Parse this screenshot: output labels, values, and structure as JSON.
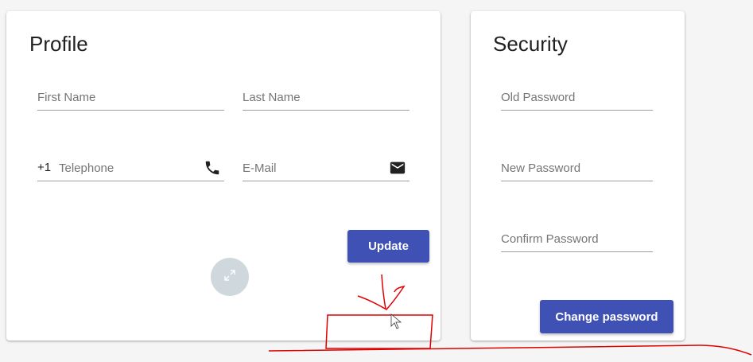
{
  "colors": {
    "page_bg": "#f5f5f5",
    "card_bg": "#ffffff",
    "primary": "#3f51b5",
    "fab": "#cfd8dc",
    "annotation": "#e00000"
  },
  "profile": {
    "title": "Profile",
    "first_name": {
      "placeholder": "First Name",
      "value": ""
    },
    "last_name": {
      "placeholder": "Last Name",
      "value": ""
    },
    "telephone": {
      "prefix": "+1",
      "placeholder": "Telephone",
      "value": "",
      "icon": "phone-icon"
    },
    "email": {
      "placeholder": "E-Mail",
      "value": "",
      "icon": "mail-icon"
    },
    "update_label": "Update",
    "fab_icon": "expand-icon"
  },
  "security": {
    "title": "Security",
    "old_password": {
      "placeholder": "Old Password",
      "value": ""
    },
    "new_password": {
      "placeholder": "New Password",
      "value": ""
    },
    "confirm_password": {
      "placeholder": "Confirm Password",
      "value": ""
    },
    "change_password_label": "Change password"
  }
}
